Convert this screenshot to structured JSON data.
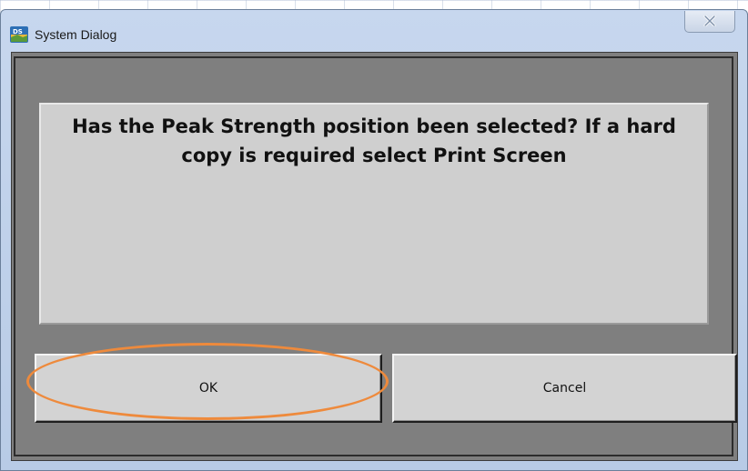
{
  "window": {
    "title": "System Dialog",
    "icon": "ds-app-icon",
    "close_icon": "close-x-icon"
  },
  "dialog": {
    "message": "Has the Peak Strength position been selected? If a hard copy is required select Print Screen",
    "buttons": {
      "ok_label": "OK",
      "cancel_label": "Cancel"
    }
  },
  "colors": {
    "highlight": "#ee8a3c",
    "client_bg": "#7f7f7f",
    "panel_bg": "#cfcfcf",
    "button_bg": "#d3d3d3"
  }
}
